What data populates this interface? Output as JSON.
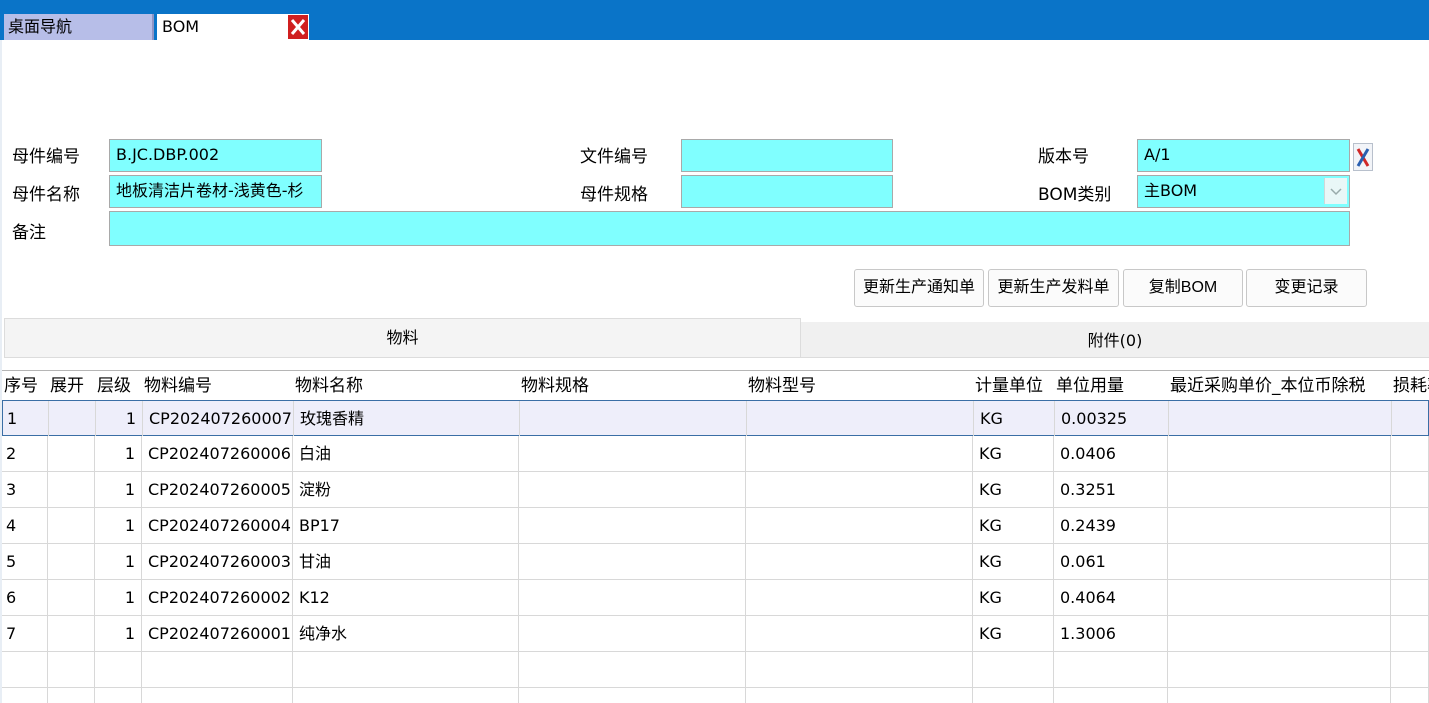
{
  "tabs": {
    "desktop_label": "桌面导航",
    "active_label": "BOM"
  },
  "form": {
    "parent_code_label": "母件编号",
    "parent_code_value": "B.JC.DBP.002",
    "parent_name_label": "母件名称",
    "parent_name_value": "地板清洁片卷材-浅黄色-杉",
    "remark_label": "备注",
    "remark_value": "",
    "doc_no_label": "文件编号",
    "doc_no_value": "",
    "parent_spec_label": "母件规格",
    "parent_spec_value": "",
    "version_label": "版本号",
    "version_value": "A/1",
    "bom_type_label": "BOM类别",
    "bom_type_value": "主BOM"
  },
  "buttons": {
    "update_notice": "更新生产通知单",
    "update_issue": "更新生产发料单",
    "copy_bom": "复制BOM",
    "change_log": "变更记录"
  },
  "section_tabs": {
    "materials": "物料",
    "attachments": "附件(0)"
  },
  "grid": {
    "headers": [
      "序号",
      "展开",
      "层级",
      "物料编号",
      "物料名称",
      "物料规格",
      "物料型号",
      "计量单位",
      "单位用量",
      "最近采购单价_本位币除税",
      "损耗率"
    ],
    "rows": [
      {
        "seq": "1",
        "expand": "",
        "level": "1",
        "code": "CP202407260007",
        "name": "玫瑰香精",
        "spec": "",
        "model": "",
        "unit": "KG",
        "qty": "0.00325",
        "price": "",
        "loss": ""
      },
      {
        "seq": "2",
        "expand": "",
        "level": "1",
        "code": "CP202407260006",
        "name": "白油",
        "spec": "",
        "model": "",
        "unit": "KG",
        "qty": "0.0406",
        "price": "",
        "loss": ""
      },
      {
        "seq": "3",
        "expand": "",
        "level": "1",
        "code": "CP202407260005",
        "name": "淀粉",
        "spec": "",
        "model": "",
        "unit": "KG",
        "qty": "0.3251",
        "price": "",
        "loss": ""
      },
      {
        "seq": "4",
        "expand": "",
        "level": "1",
        "code": "CP202407260004",
        "name": "BP17",
        "spec": "",
        "model": "",
        "unit": "KG",
        "qty": "0.2439",
        "price": "",
        "loss": ""
      },
      {
        "seq": "5",
        "expand": "",
        "level": "1",
        "code": "CP202407260003",
        "name": "甘油",
        "spec": "",
        "model": "",
        "unit": "KG",
        "qty": "0.061",
        "price": "",
        "loss": ""
      },
      {
        "seq": "6",
        "expand": "",
        "level": "1",
        "code": "CP202407260002",
        "name": "K12",
        "spec": "",
        "model": "",
        "unit": "KG",
        "qty": "0.4064",
        "price": "",
        "loss": ""
      },
      {
        "seq": "7",
        "expand": "",
        "level": "1",
        "code": "CP202407260001",
        "name": "纯净水",
        "spec": "",
        "model": "",
        "unit": "KG",
        "qty": "1.3006",
        "price": "",
        "loss": ""
      },
      {
        "seq": "",
        "expand": "",
        "level": "",
        "code": "",
        "name": "",
        "spec": "",
        "model": "",
        "unit": "",
        "qty": "",
        "price": "",
        "loss": ""
      },
      {
        "seq": "",
        "expand": "",
        "level": "",
        "code": "",
        "name": "",
        "spec": "",
        "model": "",
        "unit": "",
        "qty": "",
        "price": "",
        "loss": ""
      }
    ]
  },
  "colors": {
    "topbar": "#0a74c8",
    "field_bg": "#80ffff",
    "selected_row": "#eeeefa"
  },
  "icons": {
    "close": "close-icon",
    "tool": "tool-icon",
    "dropdown": "chevron-down-icon"
  }
}
